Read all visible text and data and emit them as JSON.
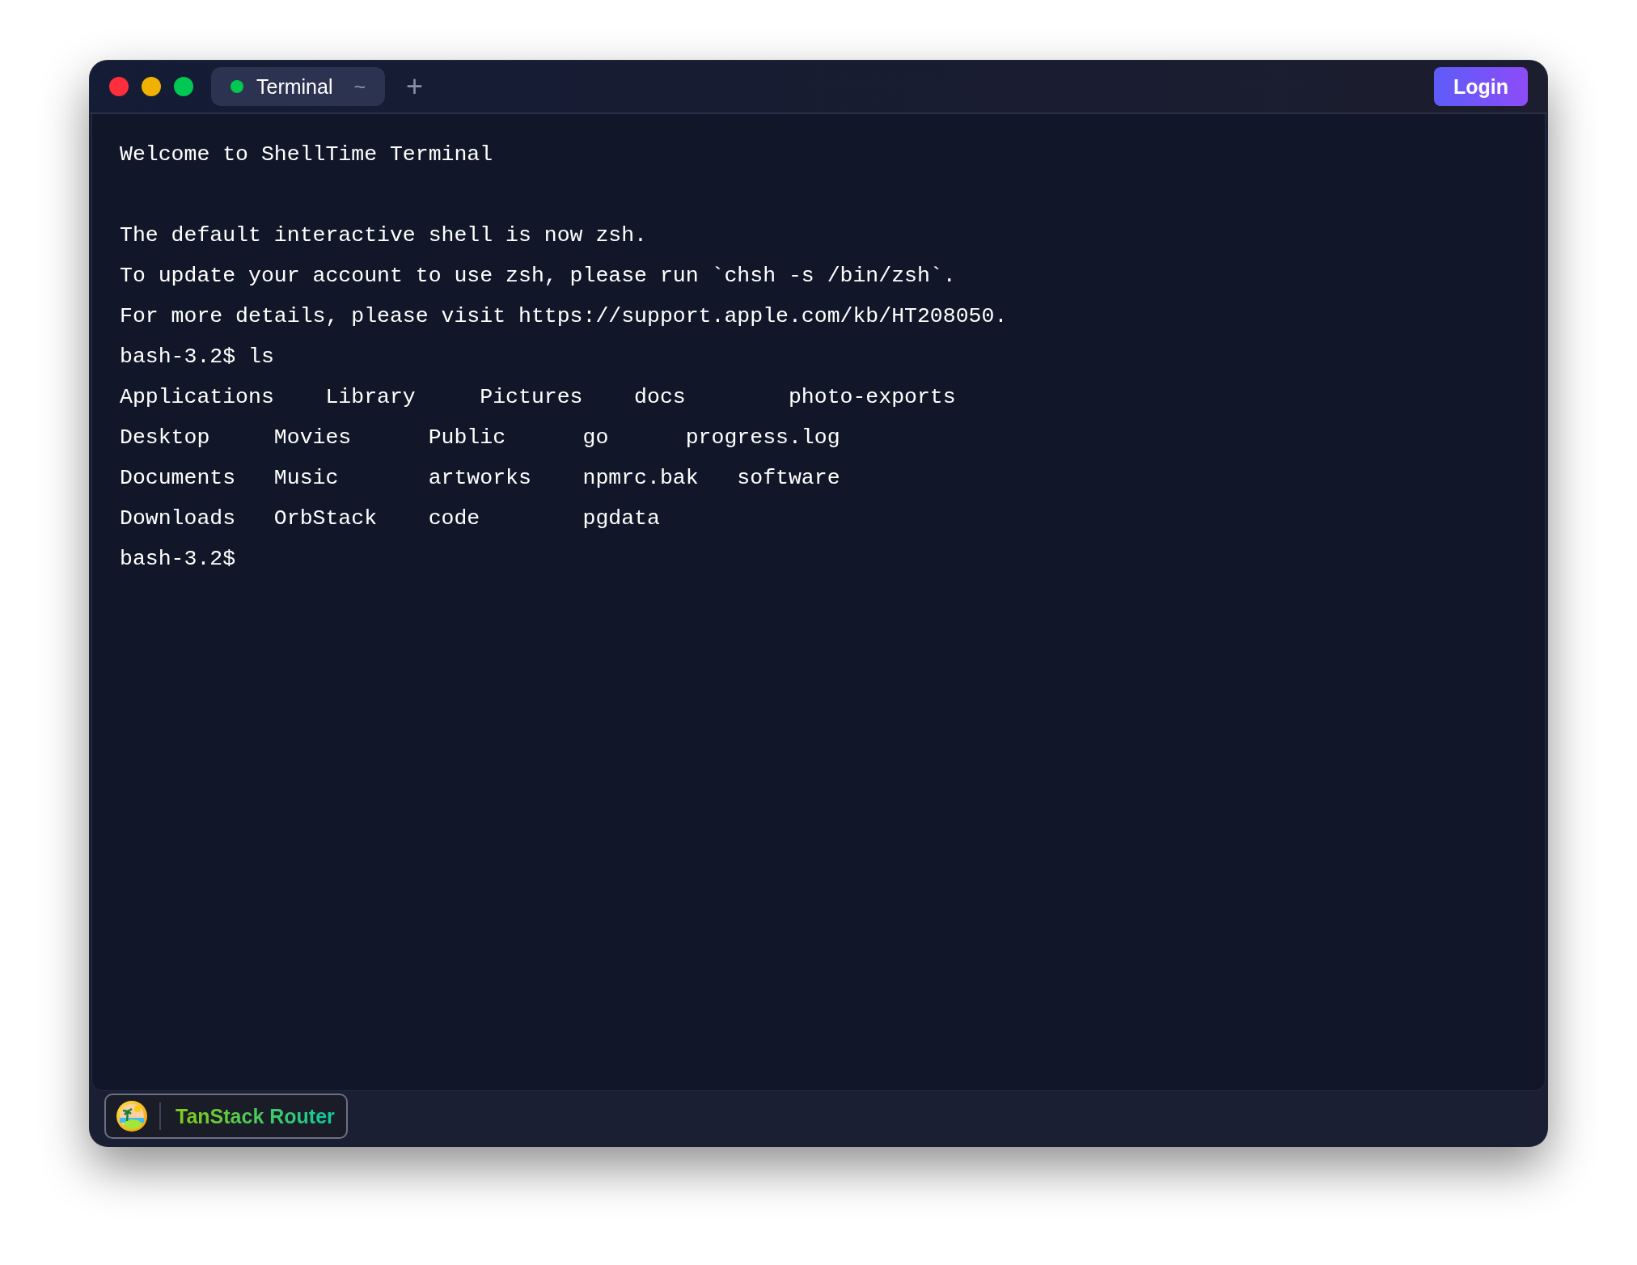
{
  "tabs": [
    {
      "label": "Terminal",
      "path": "~",
      "selected": true
    }
  ],
  "new_tab": "+",
  "login_button": "Login",
  "terminal": {
    "banner": "Welcome to ShellTime Terminal",
    "lines": [
      "The default interactive shell is now zsh.",
      "To update your account to use zsh, please run `chsh -s /bin/zsh`.",
      "For more details, please visit https://support.apple.com/kb/HT208050.",
      "bash-3.2$ ls",
      "Applications    Library     Pictures    docs        photo-exports",
      "Desktop     Movies      Public      go      progress.log",
      "Documents   Music       artworks    npmrc.bak   software",
      "Downloads   OrbStack    code        pgdata",
      "bash-3.2$"
    ]
  },
  "devtools_badge": {
    "label": "TanStack Router"
  }
}
